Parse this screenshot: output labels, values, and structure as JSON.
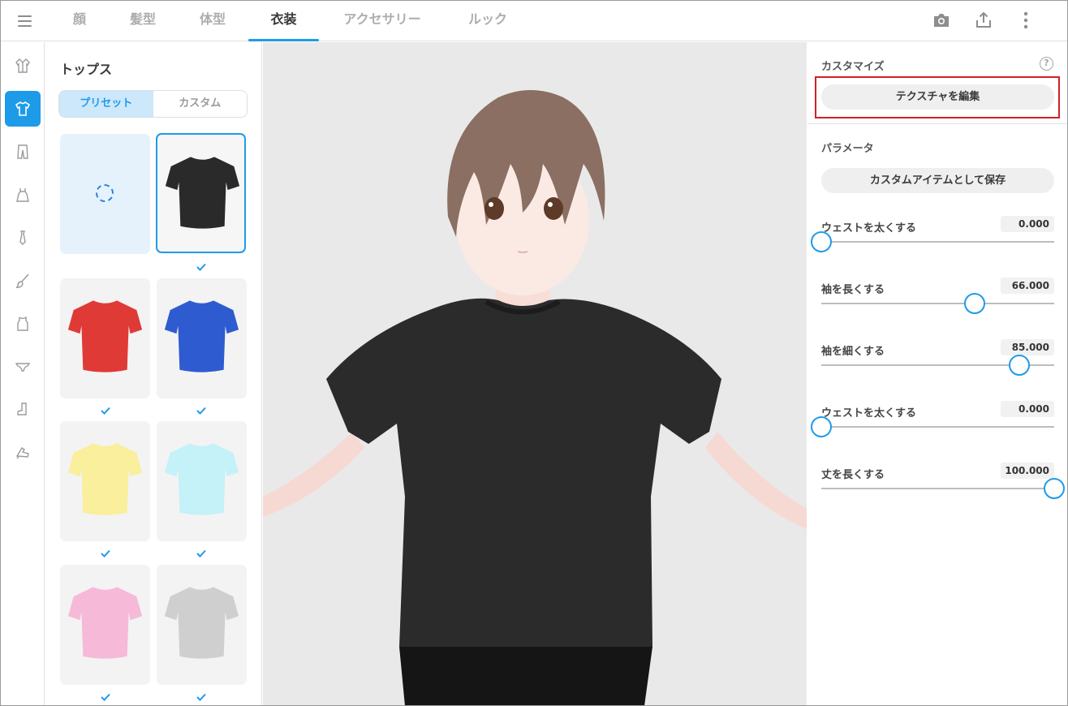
{
  "topbar": {
    "tabs": [
      {
        "label": "顔"
      },
      {
        "label": "髪型"
      },
      {
        "label": "体型"
      },
      {
        "label": "衣装"
      },
      {
        "label": "アクセサリー"
      },
      {
        "label": "ルック"
      }
    ],
    "active_tab": "衣装",
    "icons": [
      "menu-icon",
      "camera-icon",
      "share-icon",
      "more-vertical-icon"
    ]
  },
  "rail": {
    "items": [
      "outer-icon",
      "tops-icon",
      "bottoms-icon",
      "onepiece-icon",
      "necktie-icon",
      "brush-icon",
      "innerwear-icon",
      "underwear-icon",
      "socks-icon",
      "shoes-icon"
    ],
    "active_index": 1
  },
  "panel": {
    "title": "トップス",
    "segments": [
      {
        "label": "プリセット"
      },
      {
        "label": "カスタム"
      }
    ],
    "active_segment": "プリセット",
    "tiles": [
      {
        "kind": "loading"
      },
      {
        "color": "#2a2a2a",
        "selected": true
      },
      {
        "color": "#e03a36"
      },
      {
        "color": "#2f5bd1"
      },
      {
        "color": "#f9ef9c"
      },
      {
        "color": "#c5f1f8"
      },
      {
        "color": "#f7b9d8"
      },
      {
        "color": "#cfcfcf"
      }
    ]
  },
  "right": {
    "customize": {
      "title": "カスタマイズ",
      "help": "?",
      "texture_button": "テクスチャを編集"
    },
    "params_section": {
      "title": "パラメータ",
      "save_button": "カスタムアイテムとして保存",
      "sliders": [
        {
          "label": "ウェストを太くする",
          "value": "0.000",
          "fraction": 0.0
        },
        {
          "label": "袖を長くする",
          "value": "66.000",
          "fraction": 0.66
        },
        {
          "label": "袖を細くする",
          "value": "85.000",
          "fraction": 0.85
        },
        {
          "label": "ウェストを太くする",
          "value": "0.000",
          "fraction": 0.0
        },
        {
          "label": "丈を長くする",
          "value": "100.000",
          "fraction": 1.0
        }
      ]
    }
  },
  "colors": {
    "accent": "#1e9be8",
    "highlight_border": "#d0202a"
  }
}
